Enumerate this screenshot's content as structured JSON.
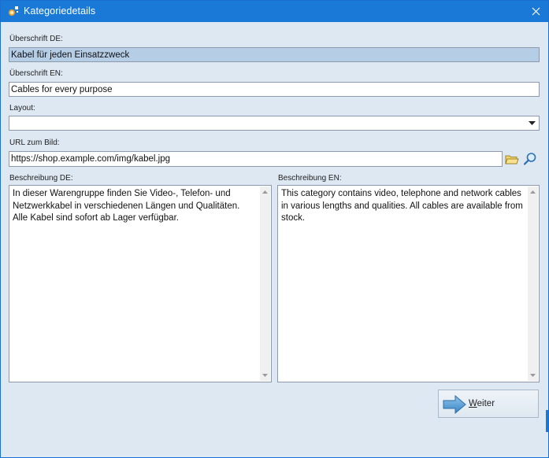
{
  "window": {
    "title": "Kategoriedetails",
    "title_color": "#1a79d6"
  },
  "fields": {
    "heading_de": {
      "label": "Überschrift DE:",
      "value": "Kabel für jeden Einsatzzweck"
    },
    "heading_en": {
      "label": "Überschrift EN:",
      "value": "Cables for every purpose"
    },
    "layout": {
      "label": "Layout:",
      "value": ""
    },
    "image_url": {
      "label": "URL zum Bild:",
      "value": "https://shop.example.com/img/kabel.jpg"
    },
    "description_de": {
      "label": "Beschreibung DE:",
      "value": "In dieser Warengruppe finden Sie Video-, Telefon- und Netzwerkkabel in verschiedenen Längen und Qualitäten. Alle Kabel sind sofort ab Lager verfügbar."
    },
    "description_en": {
      "label": "Beschreibung EN:",
      "value": "This category contains video, telephone and network cables in various lengths and qualities. All cables are available from stock."
    }
  },
  "buttons": {
    "next": {
      "underlined": "W",
      "rest": "eiter"
    }
  },
  "icons": {
    "app": "app-icon",
    "close": "close-icon",
    "dropdown": "chevron-down-icon",
    "folder": "folder-icon",
    "search": "magnifier-icon",
    "next": "arrow-right-icon"
  }
}
